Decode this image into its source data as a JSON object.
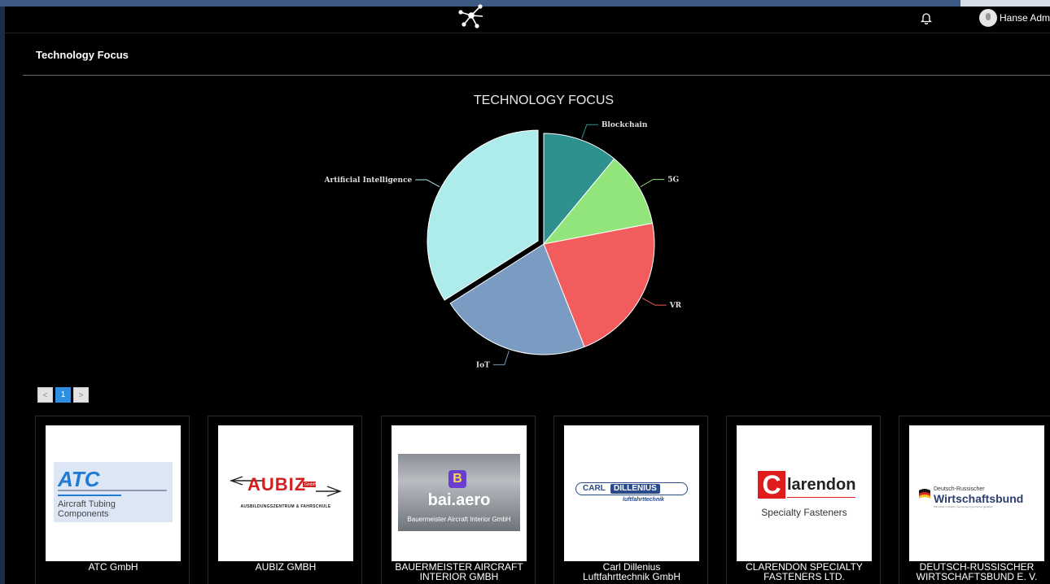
{
  "header": {
    "user_name": "Hanse Admin ⌄"
  },
  "page": {
    "title": "Technology Focus"
  },
  "chart_data": {
    "type": "pie",
    "title": "TECHNOLOGY FOCUS",
    "slices": [
      {
        "label": "Blockchain",
        "value": 11,
        "color": "#2e918e"
      },
      {
        "label": "5G",
        "value": 11,
        "color": "#92e57a"
      },
      {
        "label": "VR",
        "value": 22,
        "color": "#f25c5c"
      },
      {
        "label": "IoT",
        "value": 22,
        "color": "#7b9cc2"
      },
      {
        "label": "Artificial Intelligence",
        "value": 34,
        "color": "#aeecec"
      }
    ]
  },
  "pagination": {
    "prev": "<",
    "current": "1",
    "next": ">"
  },
  "companies": [
    {
      "name_lines": [
        "ATC GmbH"
      ],
      "logo": {
        "brand": "ATC",
        "line1": "Aircraft Tubing",
        "line2": "Components"
      }
    },
    {
      "name_lines": [
        "AUBIZ GMBH"
      ],
      "logo": {
        "brand": "AUBIZ",
        "badge": "GmbH",
        "subtitle": "Ausbildungszentrum & Fahrschule"
      }
    },
    {
      "name_lines": [
        "BAUERMEISTER AIRCRAFT",
        "INTERIOR GMBH"
      ],
      "logo": {
        "mark": "B",
        "brand": "bai.aero",
        "subtitle": "Bauermeister Aircraft Interior GmbH"
      }
    },
    {
      "name_lines": [
        "Carl Dillenius",
        "Luftfahrttechnik GmbH"
      ],
      "logo": {
        "brand_a": "CARL",
        "brand_b": "DILLENIUS",
        "subtitle": "luftfahrttechnik"
      }
    },
    {
      "name_lines": [
        "CLARENDON SPECIALTY",
        "FASTENERS LTD."
      ],
      "logo": {
        "mark": "C",
        "brand": "larendon",
        "subtitle": "Specialty Fasteners"
      }
    },
    {
      "name_lines": [
        "DEUTSCH-RUSSISCHER",
        "WIRTSCHAFTSBUND E. V."
      ],
      "logo": {
        "line1": "Deutsch-Russischer",
        "brand": "Wirtschaftsbund",
        "subtitle": "Wirtschaft im Dialog. Gemeinsam grenzenlos gestalten."
      }
    }
  ]
}
